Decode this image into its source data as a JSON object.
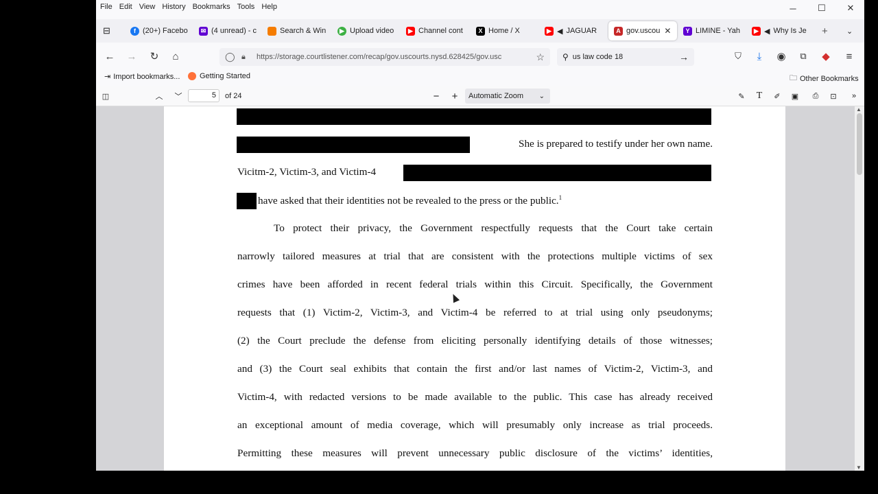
{
  "menu": [
    "File",
    "Edit",
    "View",
    "History",
    "Bookmarks",
    "Tools",
    "Help"
  ],
  "tabs": [
    {
      "label": "(20+) Facebo",
      "icon": "facebook-icon",
      "color": "#1877f2"
    },
    {
      "label": "(4 unread) - c",
      "icon": "mail-icon",
      "color": "#6001d2"
    },
    {
      "label": "Search & Win",
      "icon": "search-win-icon",
      "color": "#f57c00"
    },
    {
      "label": "Upload video",
      "icon": "upload-icon",
      "color": "#3cb043"
    },
    {
      "label": "Channel cont",
      "icon": "youtube-icon",
      "color": "#ff0000"
    },
    {
      "label": "Home / X",
      "icon": "x-icon",
      "color": "#000000"
    },
    {
      "label": "JAGUAR",
      "icon": "youtube-icon",
      "color": "#ff0000"
    },
    {
      "label": "gov.uscou",
      "icon": "pdf-icon",
      "color": "#c62828"
    },
    {
      "label": "LIMINE - Yah",
      "icon": "yahoo-icon",
      "color": "#6001d2"
    },
    {
      "label": "Why Is Je",
      "icon": "youtube-icon",
      "color": "#ff0000"
    }
  ],
  "url": "https://storage.courtlistener.com/recap/gov.uscourts.nysd.628425/gov.usc",
  "search": "us law code 18",
  "bookmarks": {
    "import": "Import bookmarks...",
    "started": "Getting Started",
    "other": "Other Bookmarks"
  },
  "pdf": {
    "page": "5",
    "of": "of 24",
    "zoom": "Automatic Zoom"
  },
  "doc": {
    "line1": "She is prepared to testify under her own name.",
    "line2": "Vicitm-2, Victim-3, and Victim-4",
    "line3": "have asked that their identities not be revealed to the press or the public.",
    "footnote": "1",
    "para": [
      "To protect their privacy, the Government respectfully requests that the Court take certain",
      "narrowly tailored measures at trial that are consistent with the protections multiple victims of sex",
      "crimes have been afforded in recent federal trials within this Circuit.  Specifically, the Government",
      "requests that (1) Victim-2, Victim-3, and Victim-4 be referred to at trial using only pseudonyms;",
      "(2) the Court preclude the defense from eliciting personally identifying details of those witnesses;",
      "and (3) the Court seal exhibits that contain the first and/or last names of Victim-2, Victim-3, and",
      "Victim-4, with redacted versions to be made available to the public.  This case has already received",
      "an exceptional amount of media coverage, which will presumably only increase as trial proceeds.",
      "Permitting these measures will prevent unnecessary public disclosure of the victims’ identities,"
    ]
  }
}
